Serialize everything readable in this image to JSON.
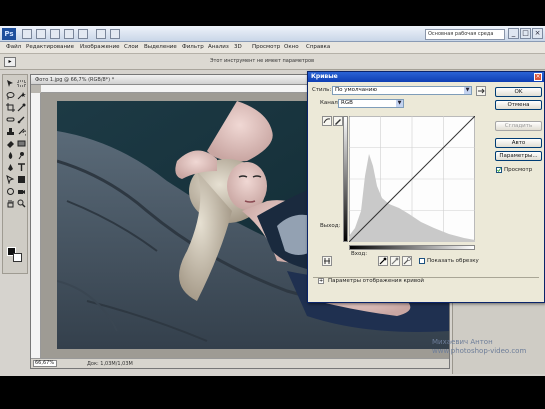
{
  "appbar": {
    "logo": "Ps",
    "workspace": "Основная рабочая среда",
    "window_buttons": [
      "_",
      "□",
      "×"
    ]
  },
  "menu": [
    "Файл",
    "Редактирование",
    "Изображение",
    "Слои",
    "Выделение",
    "Фильтр",
    "Анализ",
    "3D",
    "Просмотр",
    "Окно",
    "Справка"
  ],
  "options": {
    "hint": "Этот инструмент не имеет параметров"
  },
  "document": {
    "title": "Фото 1.jpg @ 66,7% (RGB/8*) *",
    "zoom": "66,67%",
    "info": "Док: 1,03M/1,03M"
  },
  "dialog": {
    "title": "Кривые",
    "close": "×",
    "preset_label": "Стиль:",
    "preset_value": "По умолчанию",
    "channel_label": "Канал:",
    "channel_value": "RGB",
    "output_label": "Выход:",
    "input_label": "Вход:",
    "show_clipping": "Показать обрезку",
    "display_options": "Параметры отображения кривой",
    "buttons": {
      "ok": "OK",
      "cancel": "Отмена",
      "smooth": "Сгладить",
      "auto": "Авто",
      "options": "Параметры..."
    },
    "preview_label": "Просмотр",
    "preview_checked": true
  },
  "watermark": {
    "line1": "Михаевич Антон",
    "line2": "www.photoshop-video.com"
  },
  "icons": [
    "photoshop-logo",
    "move-icon",
    "marquee-icon",
    "lasso-icon",
    "magic-wand-icon",
    "crop-icon",
    "eyedropper-icon",
    "brush-icon",
    "clone-icon",
    "eraser-icon",
    "gradient-icon",
    "pen-icon",
    "text-icon",
    "hand-icon",
    "zoom-icon",
    "curve-point-icon",
    "pencil-icon",
    "black-point-eyedropper-icon",
    "gray-point-eyedropper-icon",
    "white-point-eyedropper-icon"
  ]
}
